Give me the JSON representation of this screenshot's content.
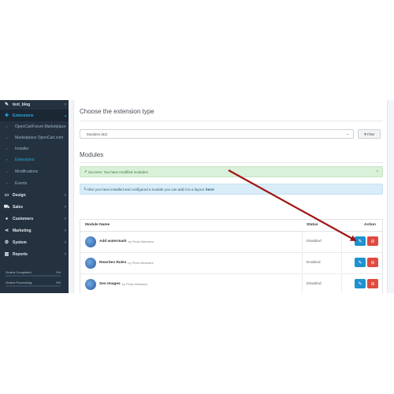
{
  "sidebar": {
    "items": [
      {
        "label": "text_blog",
        "icon": "pencil-icon",
        "kind": "top",
        "chevron": "›"
      },
      {
        "label": "Extensions",
        "icon": "puzzle-icon",
        "kind": "top active",
        "chevron": "⌄"
      },
      {
        "label": "OpenCartForum Marketplace",
        "icon": "»",
        "kind": "sub",
        "chevron": ""
      },
      {
        "label": "Marketplace OpenCart.com",
        "icon": "»",
        "kind": "sub",
        "chevron": ""
      },
      {
        "label": "Installer",
        "icon": "»",
        "kind": "sub",
        "chevron": ""
      },
      {
        "label": "Extensions",
        "icon": "»",
        "kind": "sub current",
        "chevron": ""
      },
      {
        "label": "Modifications",
        "icon": "»",
        "kind": "sub",
        "chevron": ""
      },
      {
        "label": "Events",
        "icon": "»",
        "kind": "sub",
        "chevron": ""
      },
      {
        "label": "Design",
        "icon": "monitor-icon",
        "kind": "top",
        "chevron": "›"
      },
      {
        "label": "Sales",
        "icon": "cart-icon",
        "kind": "top",
        "chevron": "›"
      },
      {
        "label": "Customers",
        "icon": "user-icon",
        "kind": "top",
        "chevron": "›"
      },
      {
        "label": "Marketing",
        "icon": "share-icon",
        "kind": "top",
        "chevron": "›"
      },
      {
        "label": "System",
        "icon": "gear-icon",
        "kind": "top",
        "chevron": "›"
      },
      {
        "label": "Reports",
        "icon": "bar-chart-icon",
        "kind": "top",
        "chevron": "›"
      }
    ],
    "stats": [
      {
        "label": "Orders Completed",
        "value": "0%"
      },
      {
        "label": "Orders Processing",
        "value": "0%"
      }
    ]
  },
  "main": {
    "section_title": "Choose the extension type",
    "select_value": "Modules (62)",
    "filter_label": "Filter",
    "modules_title": "Modules",
    "success_text": "Success: You have modified modules!",
    "info_text": "After you have installed and configured a module you can add it to a layout",
    "info_link": "here!",
    "table": {
      "headers": {
        "name": "Module Name",
        "status": "Status",
        "action": "Action"
      },
      "rows": [
        {
          "name": "Add watermark",
          "by": "by Pinta Webware",
          "status": "Disabled"
        },
        {
          "name": "Rewrites Rules",
          "by": "by Pinta Webware",
          "status": "Enabled"
        },
        {
          "name": "Seo Images",
          "by": "by Pinta Webware",
          "status": "Disabled"
        }
      ]
    }
  },
  "colors": {
    "sidebar": "#243240",
    "accent": "#25a8e0",
    "edit": "#1e91cf",
    "delete": "#e04b3f",
    "arrow": "#a11414"
  }
}
